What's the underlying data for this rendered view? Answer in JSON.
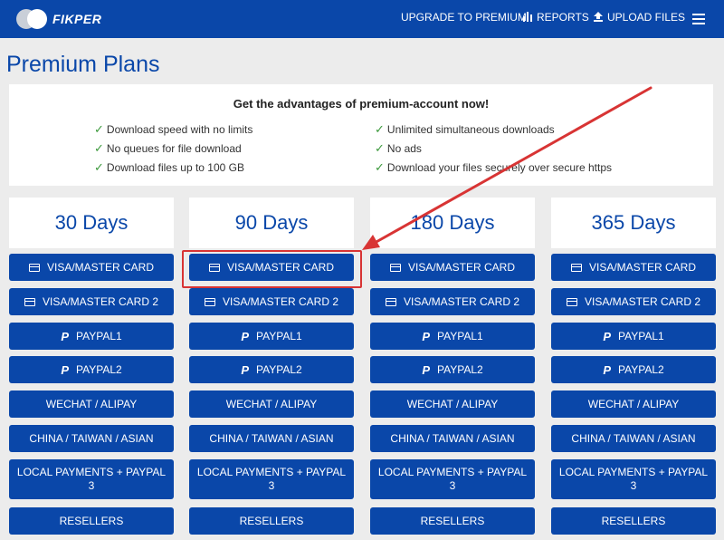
{
  "header": {
    "logo_text": "FIKPER",
    "nav": {
      "upgrade": "UPGRADE TO PREMIUM",
      "reports": "REPORTS",
      "upload": "UPLOAD FILES"
    },
    "icons": {
      "reports": "bar-chart-icon",
      "upload": "upload-icon",
      "menu": "hamburger-menu-icon"
    }
  },
  "page_title": "Premium Plans",
  "advantages": {
    "title": "Get the advantages of premium-account now!",
    "left": [
      "Download speed with no limits",
      "No queues for file download",
      "Download files up to 100 GB"
    ],
    "right": [
      "Unlimited simultaneous downloads",
      "No ads",
      "Download your files securely over secure https"
    ]
  },
  "plans": [
    {
      "period": "30 Days"
    },
    {
      "period": "90 Days"
    },
    {
      "period": "180 Days"
    },
    {
      "period": "365 Days"
    }
  ],
  "payment_methods": {
    "visa": "VISA/MASTER CARD",
    "visa2": "VISA/MASTER CARD 2",
    "paypal1": "PAYPAL1",
    "paypal2": "PAYPAL2",
    "wechat": "WECHAT / ALIPAY",
    "china": "CHINA / TAIWAN / ASIAN",
    "local": "LOCAL PAYMENTS + PAYPAL 3",
    "resellers": "RESELLERS"
  },
  "colors": {
    "brand_blue": "#0a47a9",
    "check_green": "#3d9a3d",
    "annotation_red": "#d83434"
  }
}
